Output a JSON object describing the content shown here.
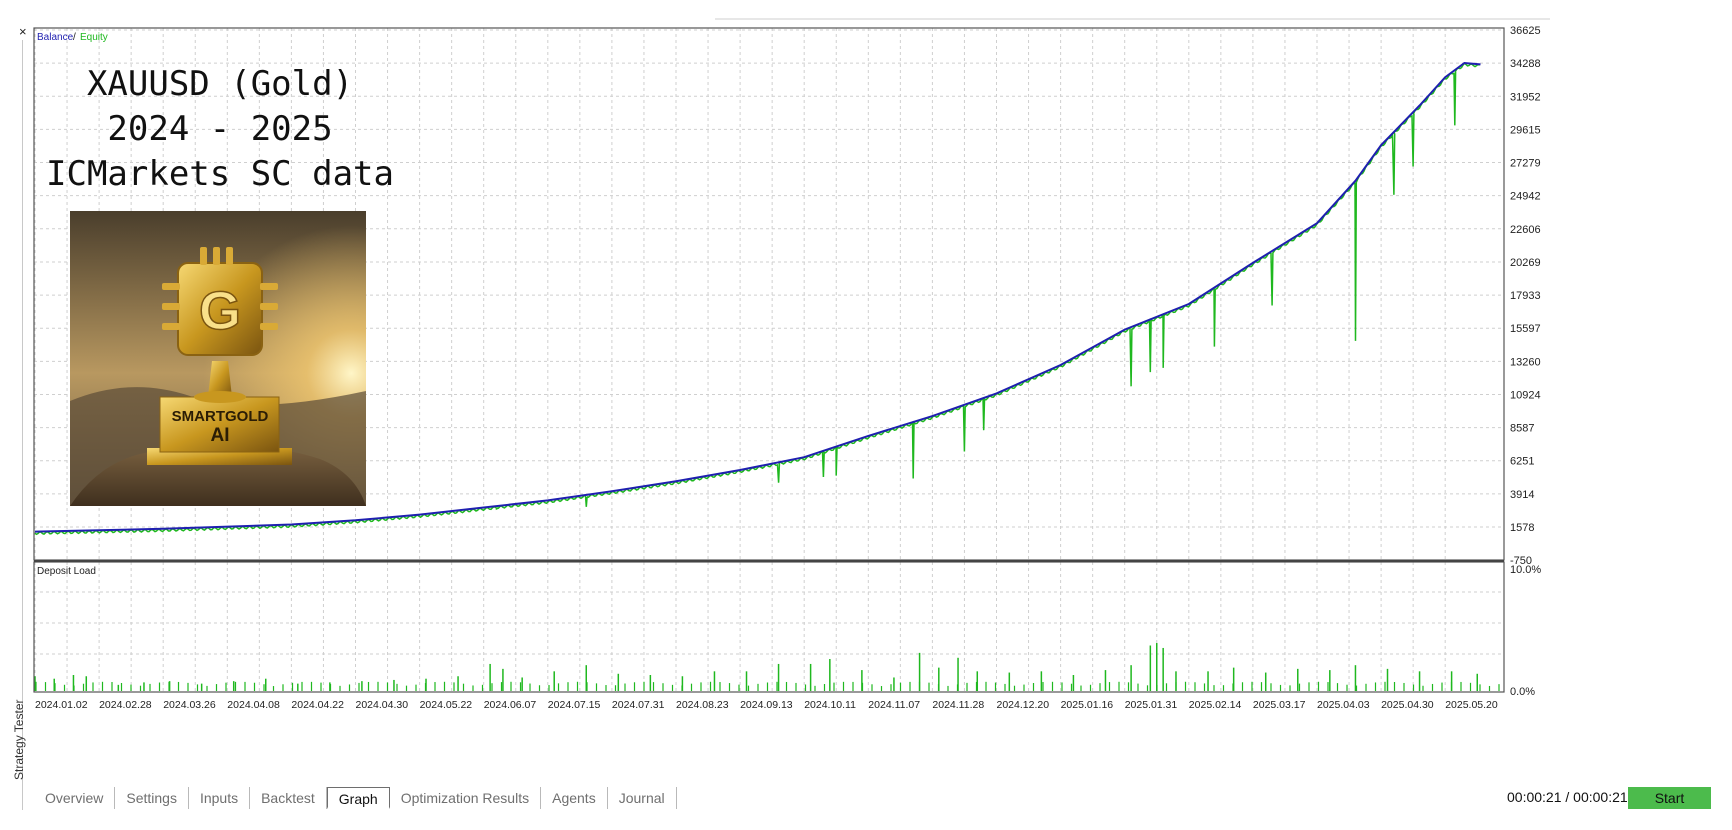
{
  "legend": {
    "balance": "Balance",
    "separator": "/",
    "equity": "Equity"
  },
  "overlay": {
    "title_lines": [
      "XAUUSD (Gold)",
      "2024 - 2025",
      "ICMarkets SC data"
    ],
    "logo_text": [
      "SMARTGOLD",
      "AI"
    ],
    "logo_letter": "G"
  },
  "subchart_label": "Deposit Load",
  "side_label": "Strategy Tester",
  "close_label": "×",
  "tabs": [
    "Overview",
    "Settings",
    "Inputs",
    "Backtest",
    "Graph",
    "Optimization Results",
    "Agents",
    "Journal"
  ],
  "active_tab": "Graph",
  "timer": "00:00:21 / 00:00:21",
  "start_label": "Start",
  "colors": {
    "balance": "#1f1fb0",
    "equity": "#1fb81f",
    "grid": "#cfcfcf",
    "frame": "#555555",
    "start": "#4cbb4c"
  },
  "chart_data": {
    "type": "line",
    "x_ticks": [
      "2024.01.02",
      "2024.02.28",
      "2024.03.26",
      "2024.04.08",
      "2024.04.22",
      "2024.04.30",
      "2024.05.22",
      "2024.06.07",
      "2024.07.15",
      "2024.07.31",
      "2024.08.23",
      "2024.09.13",
      "2024.10.11",
      "2024.11.07",
      "2024.11.28",
      "2024.12.20",
      "2025.01.16",
      "2025.01.31",
      "2025.02.14",
      "2025.03.17",
      "2025.04.03",
      "2025.04.30",
      "2025.05.20"
    ],
    "y_ticks": [
      -750,
      1578,
      3914,
      6251,
      8587,
      10924,
      13260,
      15597,
      17933,
      20269,
      22606,
      24942,
      27279,
      29615,
      31952,
      34288,
      36625
    ],
    "ylim": [
      -750,
      36625
    ],
    "grid": true,
    "balance_points": [
      [
        0,
        1250
      ],
      [
        2,
        1450
      ],
      [
        4,
        1750
      ],
      [
        5,
        2050
      ],
      [
        6,
        2450
      ],
      [
        7,
        2950
      ],
      [
        8,
        3450
      ],
      [
        9,
        4100
      ],
      [
        10,
        4800
      ],
      [
        11,
        5600
      ],
      [
        12,
        6500
      ],
      [
        13,
        8000
      ],
      [
        14,
        9400
      ],
      [
        15,
        11000
      ],
      [
        16,
        13000
      ],
      [
        17,
        15500
      ],
      [
        18,
        17300
      ],
      [
        19,
        20200
      ],
      [
        20,
        23000
      ],
      [
        20.6,
        26000
      ],
      [
        21,
        28500
      ],
      [
        21.6,
        31300
      ],
      [
        22,
        33300
      ],
      [
        22.3,
        34300
      ],
      [
        22.55,
        34200
      ]
    ],
    "equity_drawdowns": [
      [
        7.2,
        2900
      ],
      [
        8.6,
        3000
      ],
      [
        11.6,
        4700
      ],
      [
        12.3,
        5100
      ],
      [
        12.5,
        5200
      ],
      [
        13.7,
        5000
      ],
      [
        14.5,
        6900
      ],
      [
        14.8,
        8400
      ],
      [
        17.1,
        11500
      ],
      [
        17.4,
        12500
      ],
      [
        17.6,
        12800
      ],
      [
        18.4,
        14300
      ],
      [
        19.3,
        17200
      ],
      [
        20.6,
        14700
      ],
      [
        21.2,
        25000
      ],
      [
        21.5,
        27000
      ],
      [
        22.15,
        29900
      ]
    ],
    "deposit_load": {
      "label": "Deposit Load",
      "ylim": [
        0,
        10
      ],
      "y_ticks": [
        "10.0%",
        "0.0%"
      ],
      "spikes": [
        [
          0,
          1.2
        ],
        [
          0.3,
          1.0
        ],
        [
          0.6,
          1.3
        ],
        [
          0.8,
          1.2
        ],
        [
          1.3,
          0.5
        ],
        [
          1.7,
          0.7
        ],
        [
          2.1,
          0.8
        ],
        [
          2.6,
          0.6
        ],
        [
          3.1,
          0.8
        ],
        [
          3.6,
          1.0
        ],
        [
          4.1,
          0.6
        ],
        [
          4.6,
          0.7
        ],
        [
          5.1,
          0.8
        ],
        [
          5.6,
          0.9
        ],
        [
          6.1,
          1.0
        ],
        [
          6.6,
          1.2
        ],
        [
          7.1,
          2.2
        ],
        [
          7.3,
          1.8
        ],
        [
          7.6,
          1.1
        ],
        [
          8.1,
          1.6
        ],
        [
          8.6,
          2.1
        ],
        [
          9.1,
          1.4
        ],
        [
          9.6,
          1.3
        ],
        [
          10.1,
          1.2
        ],
        [
          10.6,
          1.6
        ],
        [
          11.1,
          1.6
        ],
        [
          11.6,
          2.2
        ],
        [
          12.1,
          2.2
        ],
        [
          12.4,
          2.6
        ],
        [
          12.9,
          1.7
        ],
        [
          13.4,
          1.1
        ],
        [
          13.8,
          3.1
        ],
        [
          14.1,
          1.9
        ],
        [
          14.4,
          2.7
        ],
        [
          14.7,
          1.6
        ],
        [
          15.2,
          1.5
        ],
        [
          15.7,
          1.6
        ],
        [
          16.2,
          1.3
        ],
        [
          16.7,
          1.7
        ],
        [
          17.1,
          2.1
        ],
        [
          17.4,
          3.7
        ],
        [
          17.5,
          3.9
        ],
        [
          17.6,
          3.5
        ],
        [
          17.8,
          1.6
        ],
        [
          18.3,
          1.6
        ],
        [
          18.7,
          1.9
        ],
        [
          19.2,
          1.5
        ],
        [
          19.7,
          1.8
        ],
        [
          20.2,
          1.7
        ],
        [
          20.6,
          2.1
        ],
        [
          21.1,
          1.8
        ],
        [
          21.6,
          1.6
        ],
        [
          22.1,
          1.6
        ],
        [
          22.5,
          1.4
        ]
      ]
    }
  }
}
